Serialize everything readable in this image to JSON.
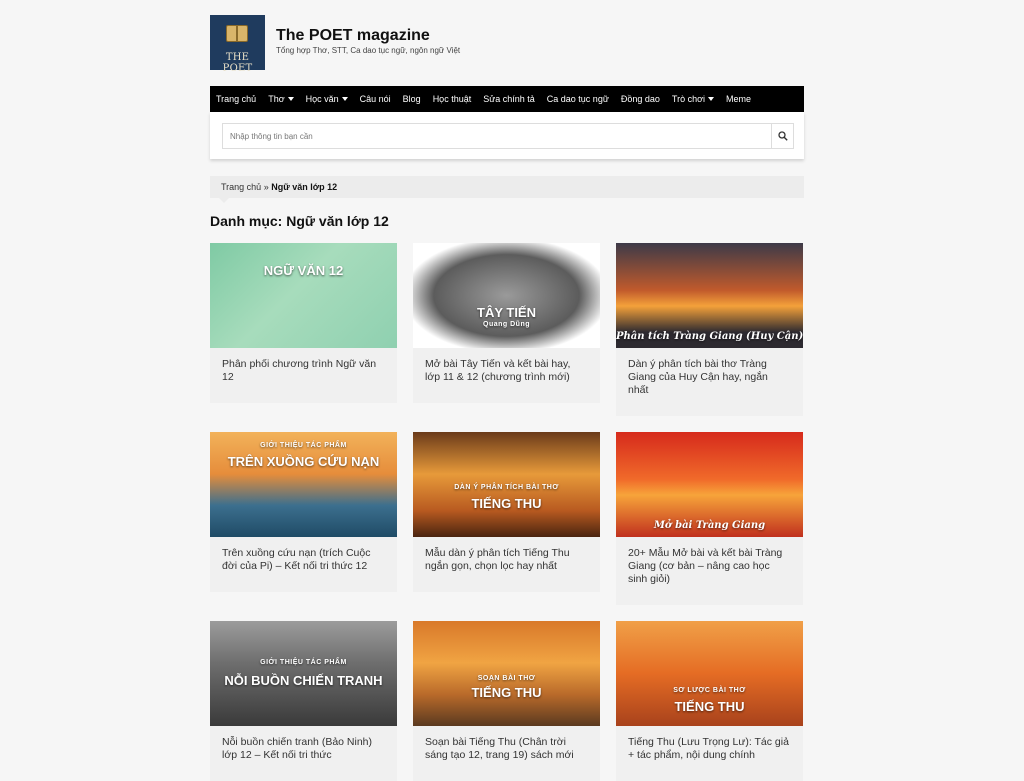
{
  "site": {
    "logo_text": "THE POET",
    "title": "The POET magazine",
    "tagline": "Tổng hợp Thơ, STT, Ca dao tục ngữ, ngôn ngữ Việt"
  },
  "nav": {
    "items": [
      {
        "label": "Trang chủ",
        "dropdown": false
      },
      {
        "label": "Thơ",
        "dropdown": true
      },
      {
        "label": "Học văn",
        "dropdown": true
      },
      {
        "label": "Câu nói",
        "dropdown": false
      },
      {
        "label": "Blog",
        "dropdown": false
      },
      {
        "label": "Học thuật",
        "dropdown": false
      },
      {
        "label": "Sửa chính tả",
        "dropdown": false
      },
      {
        "label": "Ca dao tục ngữ",
        "dropdown": false
      },
      {
        "label": "Đồng dao",
        "dropdown": false
      },
      {
        "label": "Trò chơi",
        "dropdown": true
      },
      {
        "label": "Meme",
        "dropdown": false
      }
    ]
  },
  "search": {
    "placeholder": "Nhập thông tin bạn cần",
    "value": ""
  },
  "breadcrumb": {
    "home": "Trang chủ",
    "separator": "»",
    "current": "Ngữ văn lớp 12"
  },
  "category_title": "Danh mục: Ngữ văn lớp 12",
  "articles": [
    {
      "title": "Phân phối chương trình Ngữ văn 12",
      "image_caption_small": "",
      "image_caption_big": "NGỮ VĂN 12"
    },
    {
      "title": "Mở bài Tây Tiến và kết bài hay, lớp 11 & 12 (chương trình mới)",
      "image_caption_small": "Quang Dũng",
      "image_caption_big": "TÂY TIẾN"
    },
    {
      "title": "Dàn ý phân tích bài thơ Tràng Giang của Huy Cận hay, ngắn nhất",
      "image_caption_small": "",
      "image_caption_big": "Phân tích Tràng Giang (Huy Cận)"
    },
    {
      "title": "Trên xuồng cứu nạn (trích Cuộc đời của Pi) – Kết nối tri thức 12",
      "image_caption_small": "GIỚI THIỆU TÁC PHẨM",
      "image_caption_big": "TRÊN XUỒNG CỨU NẠN"
    },
    {
      "title": "Mẫu dàn ý phân tích Tiếng Thu ngắn gọn, chọn lọc hay nhất",
      "image_caption_small": "DÀN Ý PHÂN TÍCH BÀI THƠ",
      "image_caption_big": "TIẾNG THU"
    },
    {
      "title": "20+ Mẫu Mở bài và kết bài Tràng Giang (cơ bản – nâng cao học sinh giỏi)",
      "image_caption_small": "",
      "image_caption_big": "Mở bài Tràng Giang"
    },
    {
      "title": "Nỗi buồn chiến tranh (Bảo Ninh) lớp 12 – Kết nối tri thức",
      "image_caption_small": "GIỚI THIỆU TÁC PHẨM",
      "image_caption_big": "NỖI BUỒN CHIẾN TRANH"
    },
    {
      "title": "Soạn bài Tiếng Thu (Chân trời sáng tạo 12, trang 19) sách mới",
      "image_caption_small": "SOẠN BÀI THƠ",
      "image_caption_big": "TIẾNG THU"
    },
    {
      "title": "Tiếng Thu (Lưu Trọng Lư): Tác giả + tác phẩm, nội dung chính",
      "image_caption_small": "SƠ LƯỢC BÀI THƠ",
      "image_caption_big": "TIẾNG THU"
    }
  ],
  "colors": {
    "nav_bg": "#000000",
    "logo_bg": "#1f3b5e",
    "page_bg": "#f6f6f6",
    "card_body_bg": "#f0f0f0"
  },
  "icons": {
    "search": "search-icon",
    "logo": "book-icon"
  }
}
